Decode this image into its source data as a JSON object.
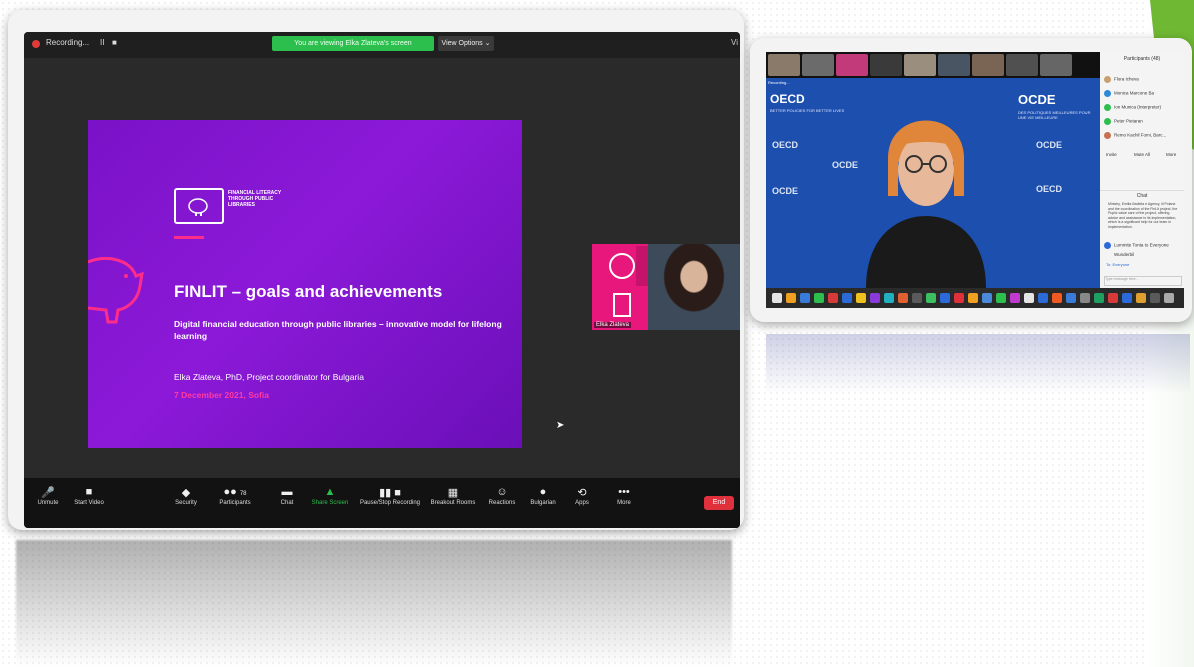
{
  "zoom": {
    "recording_label": "Recording...",
    "recording_controls": [
      "II",
      "■"
    ],
    "share_banner": "You are viewing Elka Zlateva's screen",
    "view_options": "View Options ⌄",
    "view_right": "Vi",
    "slide": {
      "logo_text": "FINANCIAL LITERACY\nTHROUGH PUBLIC\nLIBRARIES",
      "title": "FINLIT – goals and achievements",
      "subtitle": "Digital financial education through public libraries – innovative model for lifelong learning",
      "author": "Elka Zlateva, PhD, Project coordinator for Bulgaria",
      "date": "7 December 2021, Sofia"
    },
    "speaker_name": "Elka Zlateva",
    "toolbar": {
      "unmute": "Unmute",
      "start_video": "Start Video",
      "security": "Security",
      "participants": "Participants",
      "participants_count": "78",
      "chat": "Chat",
      "share_screen": "Share Screen",
      "pause_recording": "Pause/Stop Recording",
      "breakout_rooms": "Breakout Rooms",
      "reactions": "Reactions",
      "language": "Bulgarian",
      "apps": "Apps",
      "more": "More",
      "end": "End"
    }
  },
  "oecd": {
    "logo_left": "OECD",
    "logo_right": "OCDE",
    "tagline_left": "BETTER POLICIES FOR BETTER LIVES",
    "tagline_right": "DES POLITIQUES MEILLEURES POUR UNE VIE MEILLEURE",
    "recording_label": "Recording...",
    "panel": {
      "title": "Participants (48)",
      "participants": [
        "Flora Icheva",
        "Monica Marcone Ba",
        "Ion Munica (Interpreter)",
        "Peter Pietaran",
        "Remo Kachil Fomi, Barc..."
      ],
      "buttons": [
        "Invite",
        "Mute All",
        "More"
      ],
      "chat_title": "Chat",
      "chat_body": "Ministry, Emilia Iliadiela e Agency, ill Poland and the coordination of the FinLit project, the Puplic value care of the project, offering advice and assistance in its implementation, which is a significant help for our team in implementation.",
      "chat_sender": "Lummite Tonta to Everyone",
      "chat_reply": "Wunderbil",
      "chat_to": "To: Everyone",
      "chat_placeholder": "Type message here..."
    }
  },
  "colors": {
    "slide_purple": "#7a12c7",
    "accent_pink": "#ff2d8a",
    "zoom_green": "#2dbf4e",
    "end_red": "#e0303c",
    "oecd_blue": "#1c4fae",
    "brand_green": "#6fb833"
  }
}
